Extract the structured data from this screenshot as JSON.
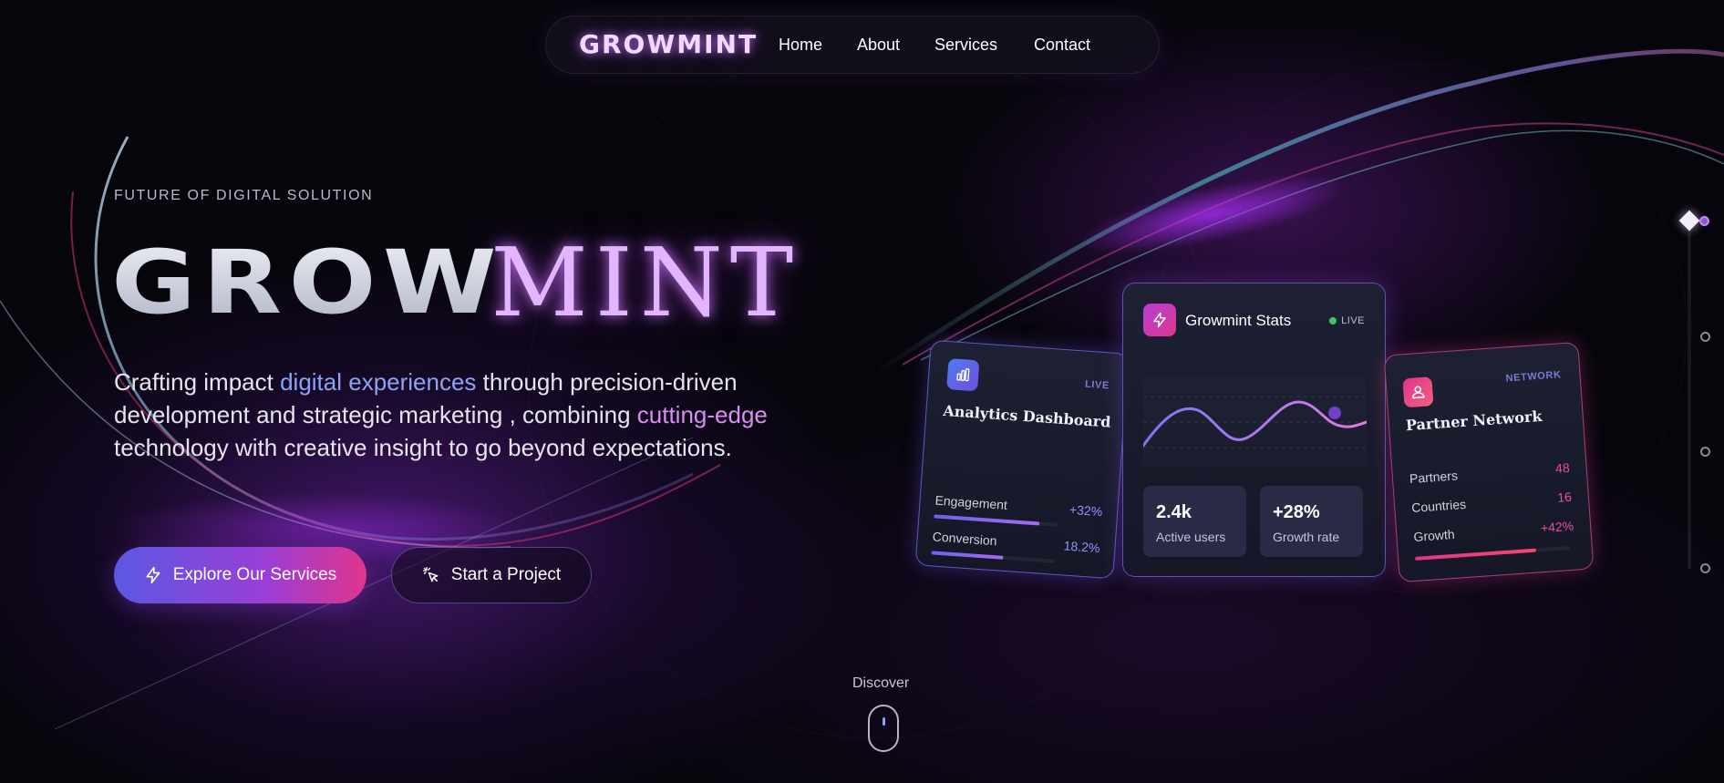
{
  "nav": {
    "logo": "GROWMINT",
    "links": [
      "Home",
      "About",
      "Services",
      "Contact"
    ]
  },
  "hero": {
    "eyebrow": "FUTURE OF DIGITAL SOLUTION",
    "title_part1": "GROW",
    "title_part2": "MINT",
    "desc_1": "Crafting impact ",
    "desc_hl1": "digital experiences",
    "desc_2": " through precision-driven development and strategic marketing , combining ",
    "desc_hl2": "cutting-edge",
    "desc_3": " technology with creative insight to go beyond expectations.",
    "primary_button": "Explore Our Services",
    "secondary_button": "Start a Project",
    "primary_icon": "lightning-icon",
    "secondary_icon": "cursor-click-icon"
  },
  "cards": {
    "analytics": {
      "tag": "LIVE",
      "title": "Analytics Dashboard",
      "icon": "bar-chart-icon",
      "metrics": [
        {
          "label": "Engagement",
          "value": "+32%",
          "fill": 0.85
        },
        {
          "label": "Conversion",
          "value": "18.2%",
          "fill": 0.58
        }
      ]
    },
    "stats": {
      "title": "Growmint Stats",
      "live": "LIVE",
      "icon": "lightning-icon",
      "stats": [
        {
          "value": "2.4k",
          "label": "Active users"
        },
        {
          "value": "+28%",
          "label": "Growth rate"
        }
      ]
    },
    "partners": {
      "tag": "NETWORK",
      "title": "Partner Network",
      "icon": "users-icon",
      "metrics": [
        {
          "label": "Partners",
          "value": "48"
        },
        {
          "label": "Countries",
          "value": "16"
        },
        {
          "label": "Growth",
          "value": "+42%",
          "fill": 0.78
        }
      ]
    }
  },
  "discover": {
    "label": "Discover"
  },
  "colors": {
    "background": "#07050c",
    "accent_purple": "#9a3ed6",
    "accent_blue": "#5b58e2",
    "accent_pink": "#e0358b",
    "live_green": "#3ec46d"
  }
}
